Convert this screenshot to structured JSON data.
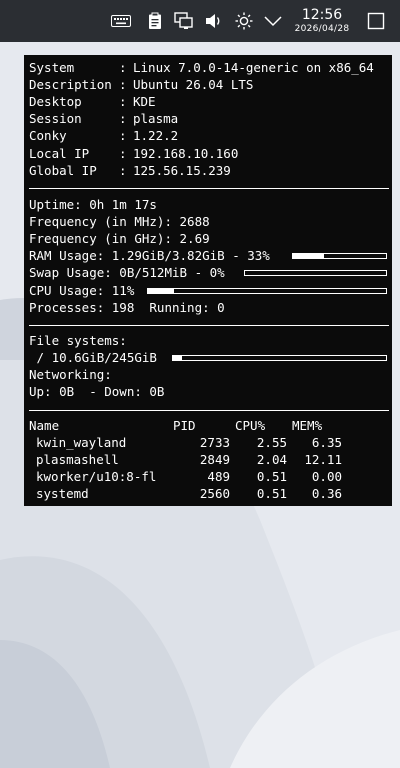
{
  "panel": {
    "time": "12:56",
    "date": "2026/04/28",
    "icons": [
      "keyboard-icon",
      "clipboard-icon",
      "network-icon",
      "volume-icon",
      "brightness-icon",
      "chevron-down-icon",
      "show-desktop-icon"
    ]
  },
  "conky": {
    "system_info": [
      {
        "key": "System",
        "value": "Linux 7.0.0-14-generic on x86_64"
      },
      {
        "key": "Description",
        "value": "Ubuntu 26.04 LTS"
      },
      {
        "key": "Desktop",
        "value": "KDE"
      },
      {
        "key": "Session",
        "value": "plasma"
      },
      {
        "key": "Conky",
        "value": "1.22.2"
      },
      {
        "key": "Local IP",
        "value": "192.168.10.160"
      },
      {
        "key": "Global IP",
        "value": "125.56.15.239"
      }
    ],
    "uptime": "Uptime: 0h 1m 17s",
    "freq_mhz": "Frequency (in MHz): 2688",
    "freq_ghz": "Frequency (in GHz): 2.69",
    "ram": {
      "text": "RAM Usage: 1.29GiB/3.82GiB - 33%",
      "percent": 33
    },
    "swap": {
      "text": "Swap Usage: 0B/512MiB - 0%",
      "percent": 0
    },
    "cpu": {
      "text": "CPU Usage: 11%",
      "percent": 11
    },
    "processes": "Processes: 198  Running: 0",
    "filesystems_label": "File systems:",
    "fs": {
      "text": " / 10.6GiB/245GiB",
      "percent": 4
    },
    "networking_label": "Networking:",
    "net": "Up: 0B  - Down: 0B",
    "proc_headers": {
      "name": "Name",
      "pid": "PID",
      "cpu": "CPU%",
      "mem": "MEM%"
    },
    "procs": [
      {
        "name": "kwin_wayland",
        "pid": "2733",
        "cpu": "2.55",
        "mem": "6.35"
      },
      {
        "name": "plasmashell",
        "pid": "2849",
        "cpu": "2.04",
        "mem": "12.11"
      },
      {
        "name": "kworker/u10:8-fl",
        "pid": "489",
        "cpu": "0.51",
        "mem": "0.00"
      },
      {
        "name": "systemd",
        "pid": "2560",
        "cpu": "0.51",
        "mem": "0.36"
      }
    ]
  }
}
